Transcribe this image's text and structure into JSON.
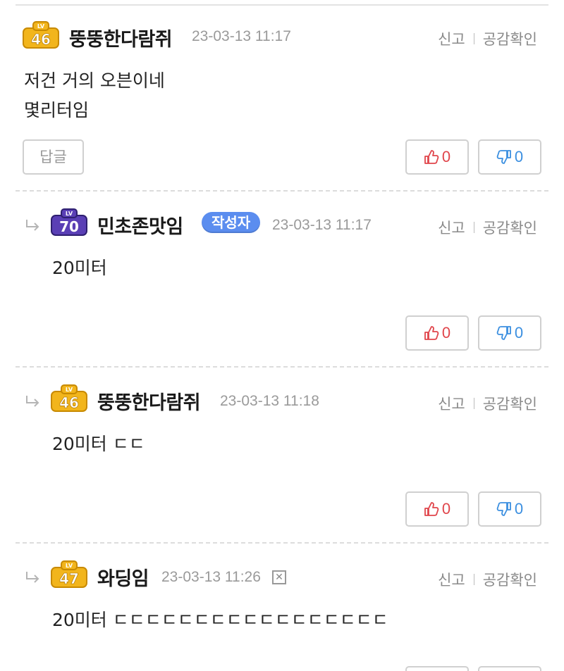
{
  "comments": [
    {
      "level": "46",
      "nickname": "뚱뚱한다람쥐",
      "date": "23-03-13 11:17",
      "report": "신고",
      "check": "공감확인",
      "lines": "저건 거의 오븐이네\n몇리터임",
      "reply_label": "답글",
      "up": "0",
      "down": "0",
      "badge_color": "#f2b51c"
    },
    {
      "level": "70",
      "nickname": "민초존맛임",
      "author_tag": "작성자",
      "date": "23-03-13 11:17",
      "report": "신고",
      "check": "공감확인",
      "lines": "20미터",
      "up": "0",
      "down": "0",
      "badge_color": "#5a3fb5"
    },
    {
      "level": "46",
      "nickname": "뚱뚱한다람쥐",
      "date": "23-03-13 11:18",
      "report": "신고",
      "check": "공감확인",
      "lines": "20미터 ㄷㄷ",
      "up": "0",
      "down": "0",
      "badge_color": "#f2b51c"
    },
    {
      "level": "47",
      "nickname": "와딩임",
      "date": "23-03-13 11:26",
      "report": "신고",
      "check": "공감확인",
      "lines": "20미터 ㄷㄷㄷㄷㄷㄷㄷㄷㄷㄷㄷㄷㄷㄷㄷㄷㄷ",
      "badge_color": "#f2b51c"
    }
  ]
}
